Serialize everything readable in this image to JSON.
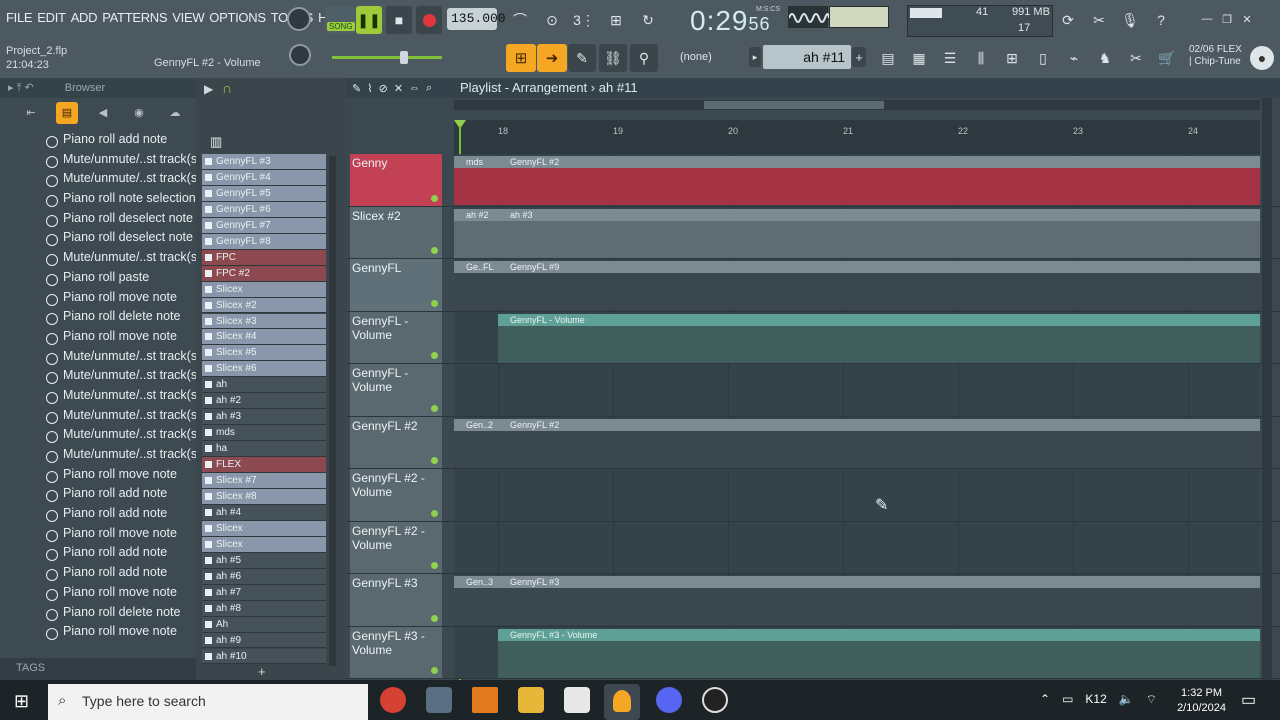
{
  "menu": [
    "FILE",
    "EDIT",
    "ADD",
    "PATTERNS",
    "VIEW",
    "OPTIONS",
    "TOOLS",
    "HELP"
  ],
  "project": {
    "name": "Project_2.flp",
    "time": "21:04:23"
  },
  "hint": "GennyFL #2 - Volume",
  "song_label": "SONG",
  "tempo": "135.000",
  "clock": {
    "main": "0:29",
    "sub": "56",
    "mode": "M:S:CS"
  },
  "cpu": {
    "value": "41",
    "ram": "991 MB",
    "poly": "17"
  },
  "pattern": {
    "selector": "(none)",
    "name": "ah #11"
  },
  "news": {
    "date": "02/06",
    "title": "FLEX",
    "sub": "| Chip-Tune"
  },
  "browser": {
    "title": "Browser",
    "history": [
      "Piano roll add note",
      "Mute/unmute/..st track(s)",
      "Mute/unmute/..st track(s)",
      "Piano roll note selection",
      "Piano roll deselect note",
      "Piano roll deselect note",
      "Mute/unmute/..st track(s)",
      "Piano roll paste",
      "Piano roll move note",
      "Piano roll delete note",
      "Piano roll move note",
      "Mute/unmute/..st track(s)",
      "Mute/unmute/..st track(s)",
      "Mute/unmute/..st track(s)",
      "Mute/unmute/..st track(s)",
      "Mute/unmute/..st track(s)",
      "Mute/unmute/..st track(s)",
      "Piano roll move note",
      "Piano roll add note",
      "Piano roll add note",
      "Piano roll move note",
      "Piano roll add note",
      "Piano roll add note",
      "Piano roll move note",
      "Piano roll delete note",
      "Piano roll move note"
    ],
    "tags": "TAGS"
  },
  "channels": [
    {
      "name": "GennyFL #3",
      "style": "bl"
    },
    {
      "name": "GennyFL #4",
      "style": "bl"
    },
    {
      "name": "GennyFL #5",
      "style": "bl"
    },
    {
      "name": "GennyFL #6",
      "style": "bl"
    },
    {
      "name": "GennyFL #7",
      "style": "bl"
    },
    {
      "name": "GennyFL #8",
      "style": "bl"
    },
    {
      "name": "FPC",
      "style": "rd"
    },
    {
      "name": "FPC #2",
      "style": "rd"
    },
    {
      "name": "Slicex",
      "style": "bl"
    },
    {
      "name": "Slicex #2",
      "style": "bl"
    },
    {
      "name": "Slicex #3",
      "style": "bl"
    },
    {
      "name": "Slicex #4",
      "style": "bl"
    },
    {
      "name": "Slicex #5",
      "style": "bl"
    },
    {
      "name": "Slicex #6",
      "style": "bl"
    },
    {
      "name": "ah",
      "style": "dk"
    },
    {
      "name": "ah #2",
      "style": "dk"
    },
    {
      "name": "ah #3",
      "style": "dk"
    },
    {
      "name": "mds",
      "style": "dk"
    },
    {
      "name": "ha",
      "style": "dk"
    },
    {
      "name": "FLEX",
      "style": "rd"
    },
    {
      "name": "Slicex #7",
      "style": "bl"
    },
    {
      "name": "Slicex #8",
      "style": "bl"
    },
    {
      "name": "ah #4",
      "style": "dk"
    },
    {
      "name": "Slicex",
      "style": "bl"
    },
    {
      "name": "Slicex",
      "style": "bl"
    },
    {
      "name": "ah #5",
      "style": "dk"
    },
    {
      "name": "ah #6",
      "style": "dk"
    },
    {
      "name": "ah #7",
      "style": "dk"
    },
    {
      "name": "ah #8",
      "style": "dk"
    },
    {
      "name": "Ah",
      "style": "dk"
    },
    {
      "name": "ah #9",
      "style": "dk"
    },
    {
      "name": "ah #10",
      "style": "dk"
    }
  ],
  "playlist": {
    "title": "Playlist - Arrangement",
    "sep": "›",
    "pattern": "ah #11",
    "bars": [
      "18",
      "19",
      "20",
      "21",
      "22",
      "23",
      "24"
    ],
    "tracks": [
      {
        "name": "Genny",
        "kind": "red",
        "clip1": "mds",
        "clip2": "GennyFL #2"
      },
      {
        "name": "Slicex #2",
        "kind": "gray",
        "clip1": "ah #2",
        "clip2": "ah #3"
      },
      {
        "name": "GennyFL",
        "kind": "dark",
        "clip1": "Ge..FL",
        "clip2": "GennyFL #9"
      },
      {
        "name": "GennyFL - Volume",
        "kind": "auto",
        "clip1": "",
        "clip2": "GennyFL - Volume"
      },
      {
        "name": "GennyFL - Volume",
        "kind": "empty",
        "clip1": "",
        "clip2": ""
      },
      {
        "name": "GennyFL #2",
        "kind": "dark",
        "clip1": "Gen..2",
        "clip2": "GennyFL #2"
      },
      {
        "name": "GennyFL #2 - Volume",
        "kind": "empty",
        "clip1": "",
        "clip2": ""
      },
      {
        "name": "GennyFL #2 - Volume",
        "kind": "empty",
        "clip1": "",
        "clip2": ""
      },
      {
        "name": "GennyFL #3",
        "kind": "dark",
        "clip1": "Gen..3",
        "clip2": "GennyFL #3"
      },
      {
        "name": "GennyFL #3 - Volume",
        "kind": "auto",
        "clip1": "",
        "clip2": "GennyFL #3 - Volume"
      }
    ]
  },
  "taskbar": {
    "search_placeholder": "Type here to search",
    "time": "1:32 PM",
    "date": "2/10/2024",
    "lang": "K12"
  }
}
